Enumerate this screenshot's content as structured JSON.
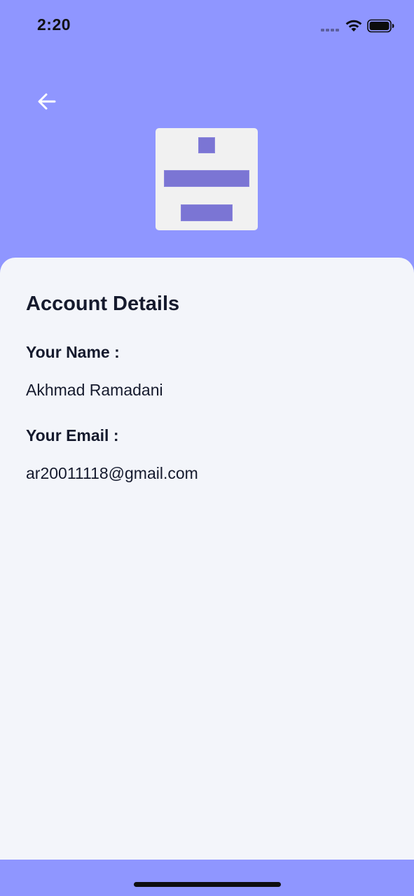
{
  "status_bar": {
    "time": "2:20",
    "icons": [
      "signal-dots-icon",
      "wifi-icon",
      "battery-icon"
    ]
  },
  "header": {
    "back_icon": "arrow-left-icon",
    "logo_icon": "app-logo-icon"
  },
  "account": {
    "title": "Account Details",
    "name_label": "Your Name :",
    "name_value": "Akhmad Ramadani",
    "email_label": "Your Email :",
    "email_value": "ar20011118@gmail.com"
  },
  "colors": {
    "header_background": "#8F96FF",
    "card_background": "#F3F5FA",
    "logo_accent": "#7B75D4",
    "text": "#151A2D"
  }
}
